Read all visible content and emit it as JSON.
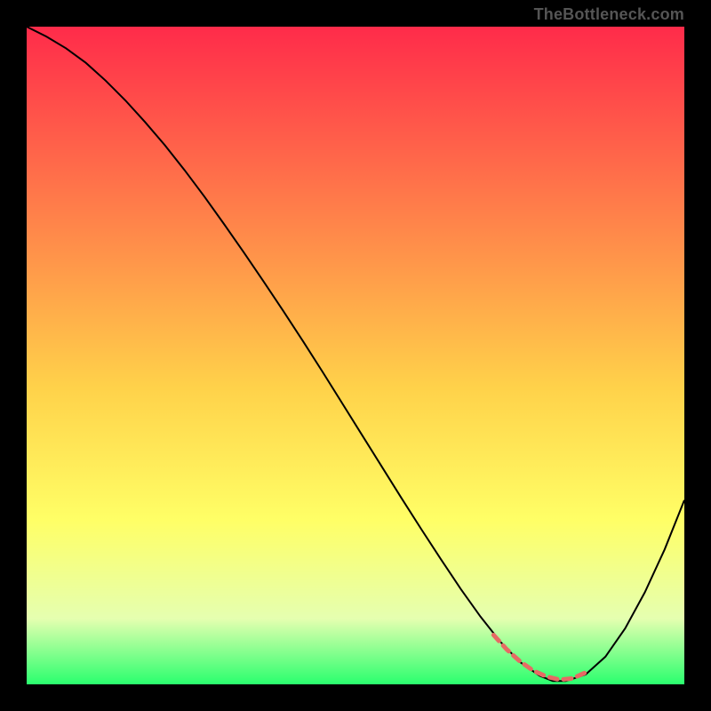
{
  "attribution": "TheBottleneck.com",
  "colors": {
    "background": "#000000",
    "curve": "#000000",
    "segment": "#e66a64",
    "gradient_top": "#ff2b4a",
    "gradient_mid1": "#ff944a",
    "gradient_mid2": "#ffd24a",
    "gradient_mid3": "#ffff66",
    "gradient_mid4": "#e5ffb0",
    "gradient_bottom": "#2aff6e"
  },
  "chart_data": {
    "type": "line",
    "title": "",
    "xlabel": "",
    "ylabel": "",
    "xlim": [
      0,
      100
    ],
    "ylim": [
      0,
      100
    ],
    "grid": false,
    "legend": false,
    "x": [
      0,
      3,
      6,
      9,
      12,
      15,
      18,
      21,
      24,
      27,
      30,
      33,
      36,
      39,
      42,
      45,
      48,
      51,
      54,
      57,
      60,
      63,
      66,
      69,
      72,
      75,
      78,
      80,
      82,
      85,
      88,
      91,
      94,
      97,
      100
    ],
    "values": [
      100,
      98.5,
      96.7,
      94.5,
      91.8,
      88.8,
      85.5,
      82,
      78.2,
      74.2,
      70,
      65.7,
      61.3,
      56.8,
      52.2,
      47.5,
      42.7,
      37.9,
      33.1,
      28.3,
      23.6,
      19,
      14.5,
      10.3,
      6.5,
      3.4,
      1.3,
      0.5,
      0.5,
      1.5,
      4.2,
      8.5,
      14,
      20.5,
      28
    ],
    "highlight_segment": {
      "x": [
        71,
        73,
        75,
        77,
        79,
        81,
        83,
        85
      ],
      "values": [
        7.5,
        5.3,
        3.5,
        2.1,
        1.2,
        0.7,
        0.9,
        1.8
      ],
      "color_key": "segment",
      "style": "dashed"
    },
    "gradient_background": {
      "type": "vertical",
      "stops": [
        {
          "offset": 0,
          "color_key": "gradient_top"
        },
        {
          "offset": 35,
          "color_key": "gradient_mid1"
        },
        {
          "offset": 55,
          "color_key": "gradient_mid2"
        },
        {
          "offset": 75,
          "color_key": "gradient_mid3"
        },
        {
          "offset": 90,
          "color_key": "gradient_mid4"
        },
        {
          "offset": 100,
          "color_key": "gradient_bottom"
        }
      ]
    }
  }
}
